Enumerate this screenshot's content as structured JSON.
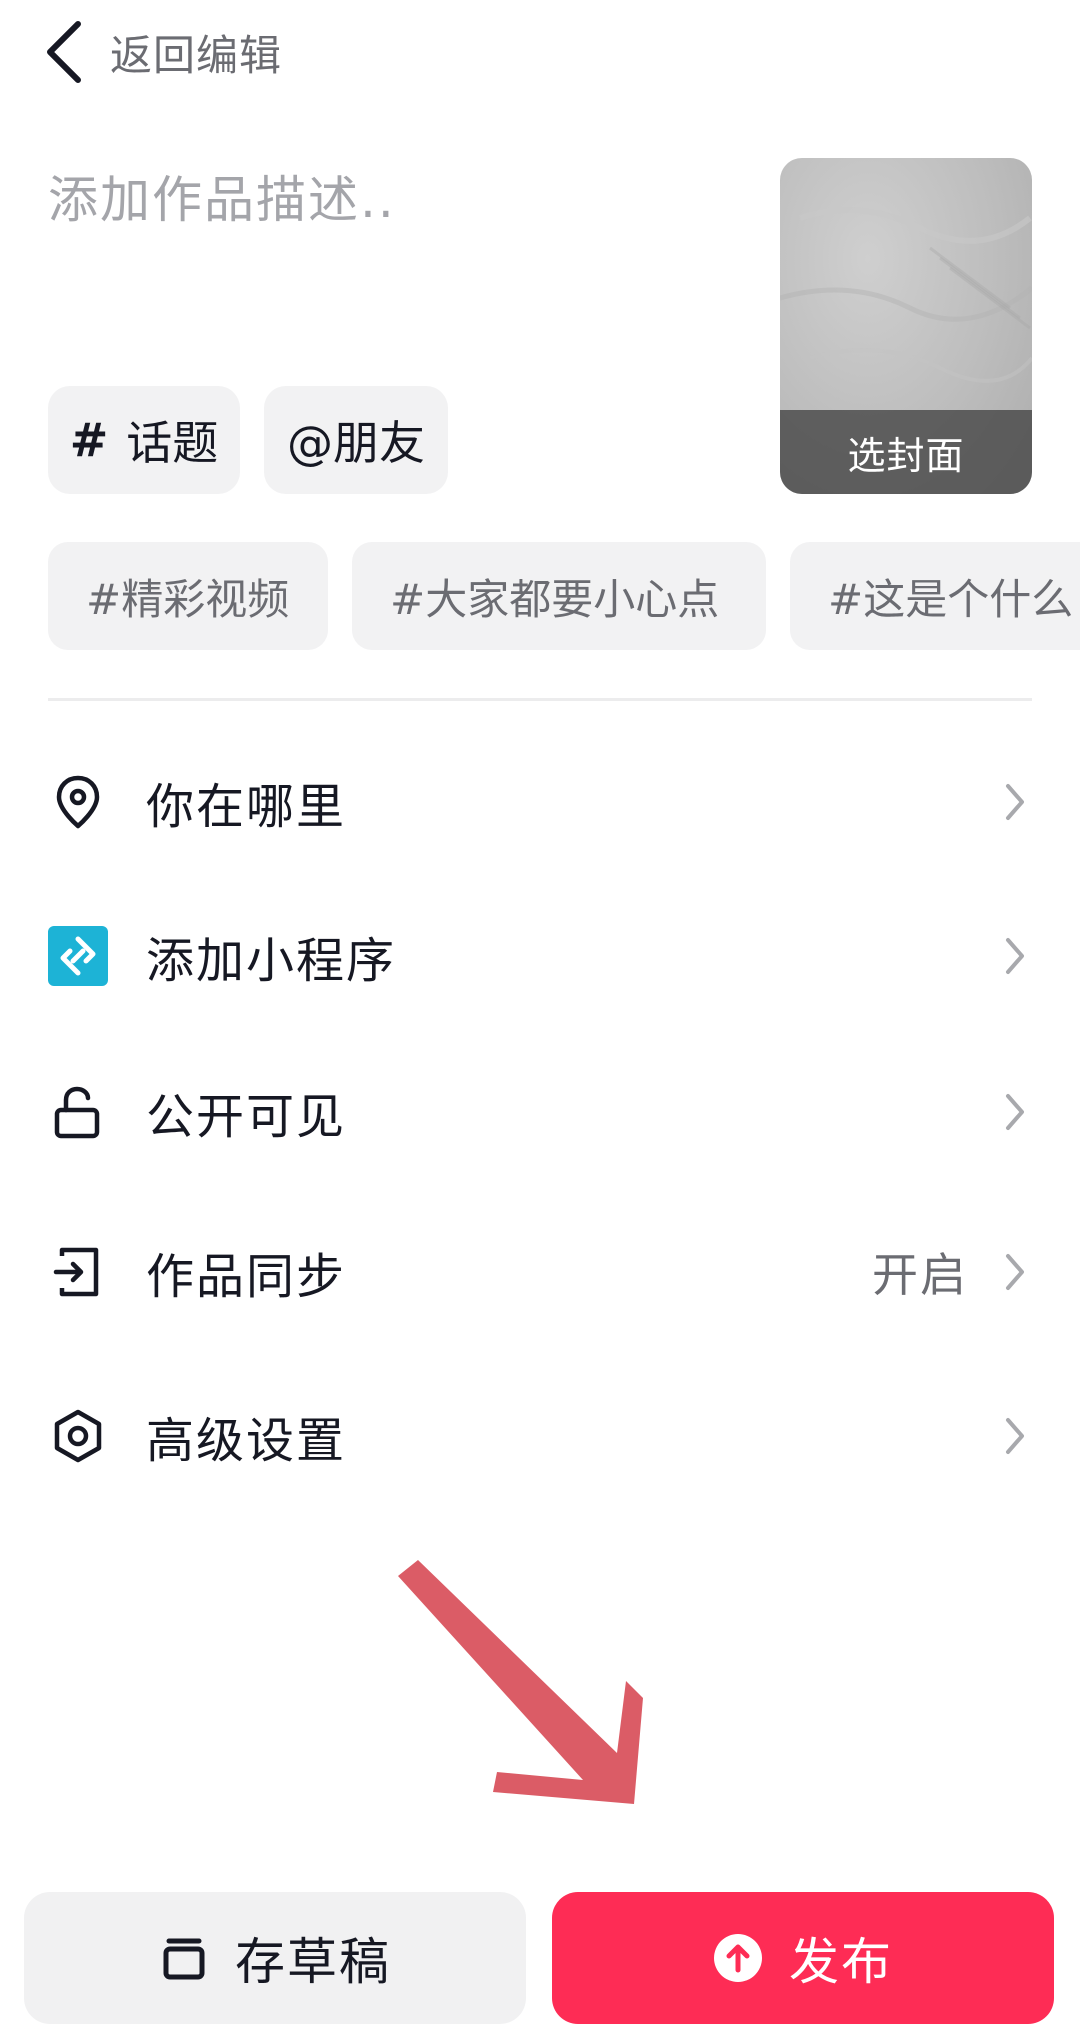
{
  "header": {
    "back_label": "返回编辑"
  },
  "description": {
    "placeholder": "添加作品描述.."
  },
  "cover": {
    "label": "选封面"
  },
  "chips": {
    "topic": "话题",
    "topic_prefix": "#",
    "friend": "@朋友"
  },
  "suggested_topics": [
    "#精彩视频",
    "#大家都要小心点",
    "#这是个什么"
  ],
  "menu": [
    {
      "label": "你在哪里",
      "icon": "location-pin-icon",
      "value": ""
    },
    {
      "label": "添加小程序",
      "icon": "mini-program-icon",
      "value": ""
    },
    {
      "label": "公开可见",
      "icon": "unlock-icon",
      "value": ""
    },
    {
      "label": "作品同步",
      "icon": "sync-export-icon",
      "value": "开启"
    },
    {
      "label": "高级设置",
      "icon": "settings-hexagon-icon",
      "value": ""
    }
  ],
  "footer": {
    "draft_label": "存草稿",
    "publish_label": "发布"
  },
  "colors": {
    "accent": "#fe2c55",
    "mini_program": "#1db3d6",
    "overlay_arrow": "#d9535e"
  }
}
